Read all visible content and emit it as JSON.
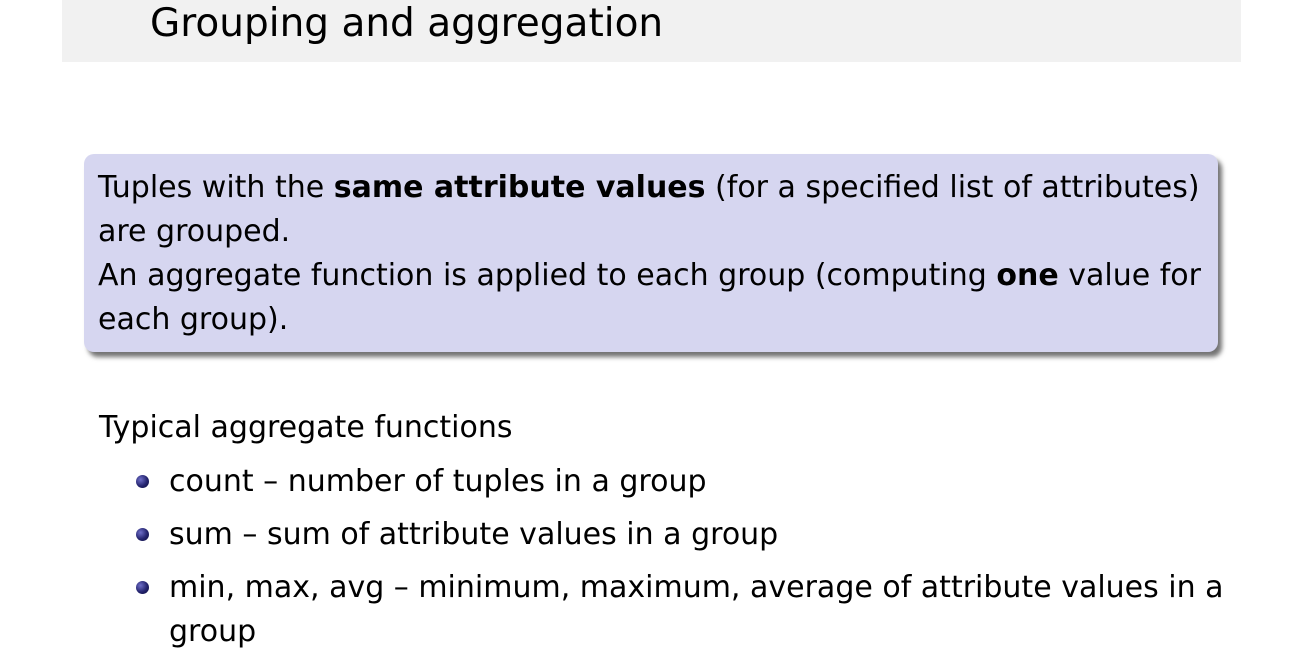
{
  "slide": {
    "title": "Grouping and aggregation"
  },
  "block": {
    "line1_pre": "Tuples with the ",
    "line1_bold": "same attribute values",
    "line1_post": " (for a specified list of attributes) are grouped.",
    "line2_pre": "An aggregate function is applied to each group (computing ",
    "line2_bold": "one",
    "line2_post": " value for each group)."
  },
  "functions": {
    "heading": "Typical aggregate functions",
    "items": [
      {
        "label": "count – number of tuples in a group"
      },
      {
        "label": "sum – sum of attribute values in a group"
      },
      {
        "label": "min, max, avg – minimum, maximum, average of attribute values in a group"
      }
    ]
  },
  "colors": {
    "block_background": "#d6d6f0",
    "title_bar_background": "#f1f1f1",
    "bullet": "#24246e"
  }
}
